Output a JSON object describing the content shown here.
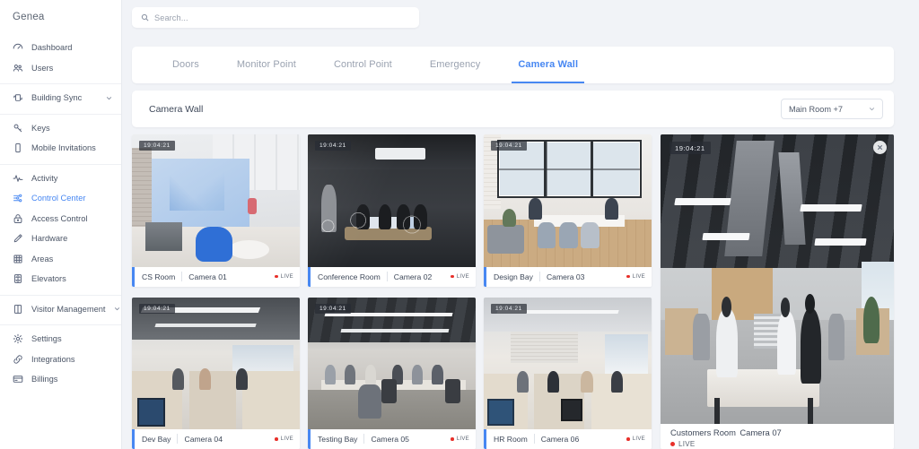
{
  "sidebar": {
    "brand": "Genea",
    "groups": [
      {
        "items": [
          {
            "label": "Dashboard",
            "icon": "dashboard-icon",
            "active": false,
            "caret": false
          },
          {
            "label": "Users",
            "icon": "users-icon",
            "active": false,
            "caret": false
          }
        ]
      },
      {
        "items": [
          {
            "label": "Building Sync",
            "icon": "building-sync-icon",
            "active": false,
            "caret": true
          }
        ]
      },
      {
        "items": [
          {
            "label": "Keys",
            "icon": "key-icon",
            "active": false,
            "caret": false
          },
          {
            "label": "Mobile Invitations",
            "icon": "mobile-icon",
            "active": false,
            "caret": false
          }
        ]
      },
      {
        "items": [
          {
            "label": "Activity",
            "icon": "activity-icon",
            "active": false,
            "caret": false
          },
          {
            "label": "Control Center",
            "icon": "control-center-icon",
            "active": true,
            "caret": false
          },
          {
            "label": "Access Control",
            "icon": "lock-icon",
            "active": false,
            "caret": false
          },
          {
            "label": "Hardware",
            "icon": "hardware-icon",
            "active": false,
            "caret": false
          },
          {
            "label": "Areas",
            "icon": "areas-grid-icon",
            "active": false,
            "caret": false
          },
          {
            "label": "Elevators",
            "icon": "elevator-icon",
            "active": false,
            "caret": false
          }
        ]
      },
      {
        "items": [
          {
            "label": "Visitor Management",
            "icon": "visitor-door-icon",
            "active": false,
            "caret": true
          }
        ]
      },
      {
        "items": [
          {
            "label": "Settings",
            "icon": "gear-icon",
            "active": false,
            "caret": false
          },
          {
            "label": "Integrations",
            "icon": "link-icon",
            "active": false,
            "caret": false
          },
          {
            "label": "Billings",
            "icon": "card-icon",
            "active": false,
            "caret": false
          }
        ]
      }
    ]
  },
  "search": {
    "placeholder": "Search...",
    "value": "",
    "icon": "search-icon"
  },
  "tabs": [
    {
      "label": "Doors",
      "active": false
    },
    {
      "label": "Monitor Point",
      "active": false
    },
    {
      "label": "Control Point",
      "active": false
    },
    {
      "label": "Emergency",
      "active": false
    },
    {
      "label": "Camera Wall",
      "active": true
    }
  ],
  "panel": {
    "title": "Camera Wall",
    "room_select": {
      "value": "Main Room +7",
      "icon": "chevron-down-icon"
    }
  },
  "cameras": [
    {
      "room": "CS Room",
      "camera": "Camera 01",
      "live": "LIVE",
      "timestamp": "19:04:21",
      "scene": "s1"
    },
    {
      "room": "Conference Room",
      "camera": "Camera 02",
      "live": "LIVE",
      "timestamp": "19:04:21",
      "scene": "s2"
    },
    {
      "room": "Design Bay",
      "camera": "Camera 03",
      "live": "LIVE",
      "timestamp": "19:04:21",
      "scene": "s3"
    },
    {
      "room": "Dev Bay",
      "camera": "Camera 04",
      "live": "LIVE",
      "timestamp": "19:04:21",
      "scene": "s4"
    },
    {
      "room": "Testing Bay",
      "camera": "Camera 05",
      "live": "LIVE",
      "timestamp": "19:04:21",
      "scene": "s5"
    },
    {
      "room": "HR Room",
      "camera": "Camera 06",
      "live": "LIVE",
      "timestamp": "19:04:21",
      "scene": "s6"
    }
  ],
  "featured_camera": {
    "room": "Customers Room",
    "camera": "Camera 07",
    "live": "LIVE",
    "timestamp": "19:04:21",
    "close_icon": "close-icon",
    "scene": "s7"
  },
  "colors": {
    "accent": "#4787f2",
    "live": "#e8302a",
    "page_bg": "#f1f3f7",
    "surface": "#ffffff",
    "text": "#3e4859",
    "muted": "#9aa2b0"
  }
}
